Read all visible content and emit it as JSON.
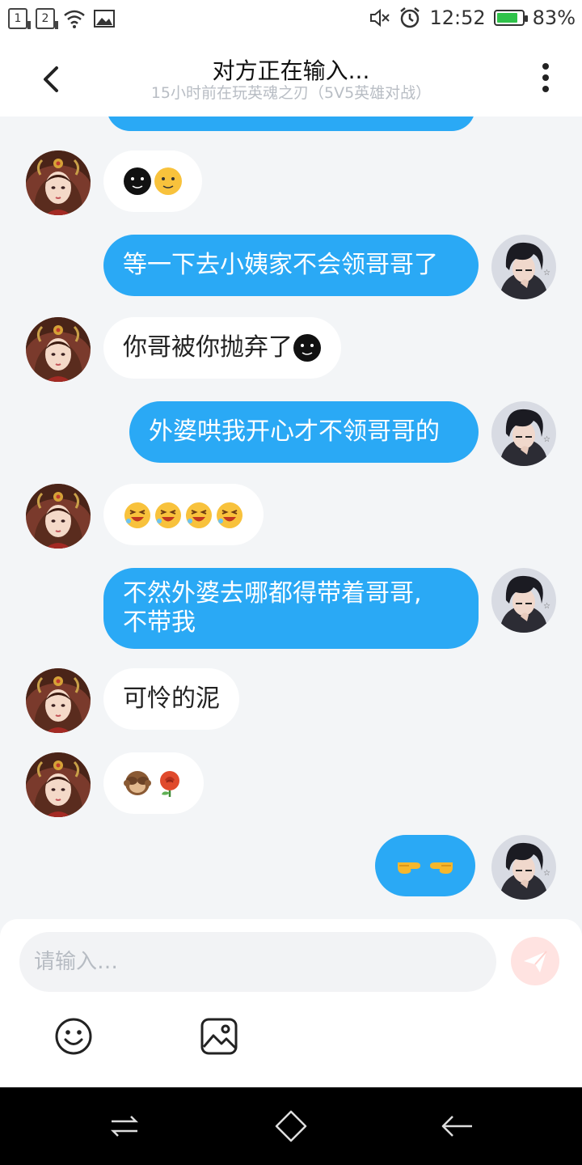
{
  "status_bar": {
    "sim1": "1",
    "sim2": "2",
    "time": "12:52",
    "battery_percent": "83%",
    "battery_level": 0.83,
    "icons": [
      "wifi-icon",
      "gallery-icon",
      "mute-icon",
      "alarm-icon",
      "battery-icon"
    ]
  },
  "header": {
    "title": "对方正在输入...",
    "subtitle": "15小时前在玩英魂之刃（5V5英雄对战）",
    "back_icon": "chevron-left-icon",
    "more_icon": "more-vertical-icon"
  },
  "messages": [
    {
      "side": "in",
      "text": "",
      "emojis": [
        "dark-smile-emoji",
        "yellow-smile-emoji"
      ]
    },
    {
      "side": "out",
      "text": "等一下去小姨家不会领哥哥了"
    },
    {
      "side": "in",
      "text": "你哥被你抛弃了",
      "emojis": [
        "dark-smile-emoji"
      ]
    },
    {
      "side": "out",
      "text": "外婆哄我开心才不领哥哥的"
    },
    {
      "side": "in",
      "text": "",
      "emojis": [
        "laughing-emoji",
        "laughing-emoji",
        "laughing-emoji",
        "laughing-emoji"
      ]
    },
    {
      "side": "out",
      "lines": [
        "不然外婆去哪都得带着哥哥,",
        "不带我"
      ]
    },
    {
      "side": "in",
      "text": "可怜的泥"
    },
    {
      "side": "in",
      "text": "",
      "emojis": [
        "see-no-evil-monkey-emoji",
        "rose-emoji"
      ]
    },
    {
      "side": "out",
      "text": "",
      "emojis": [
        "pointing-right-emoji",
        "pointing-left-emoji"
      ]
    }
  ],
  "input": {
    "placeholder": "请输入…",
    "send_icon": "send-icon",
    "emoji_button_icon": "smiley-icon",
    "image_button_icon": "image-icon"
  },
  "nav_bar": {
    "icons": [
      "switch-icon",
      "home-icon",
      "back-arrow-icon"
    ]
  },
  "colors": {
    "outgoing_bubble": "#2aa9f5",
    "incoming_bubble": "#ffffff",
    "chat_background": "#f3f5f7"
  }
}
